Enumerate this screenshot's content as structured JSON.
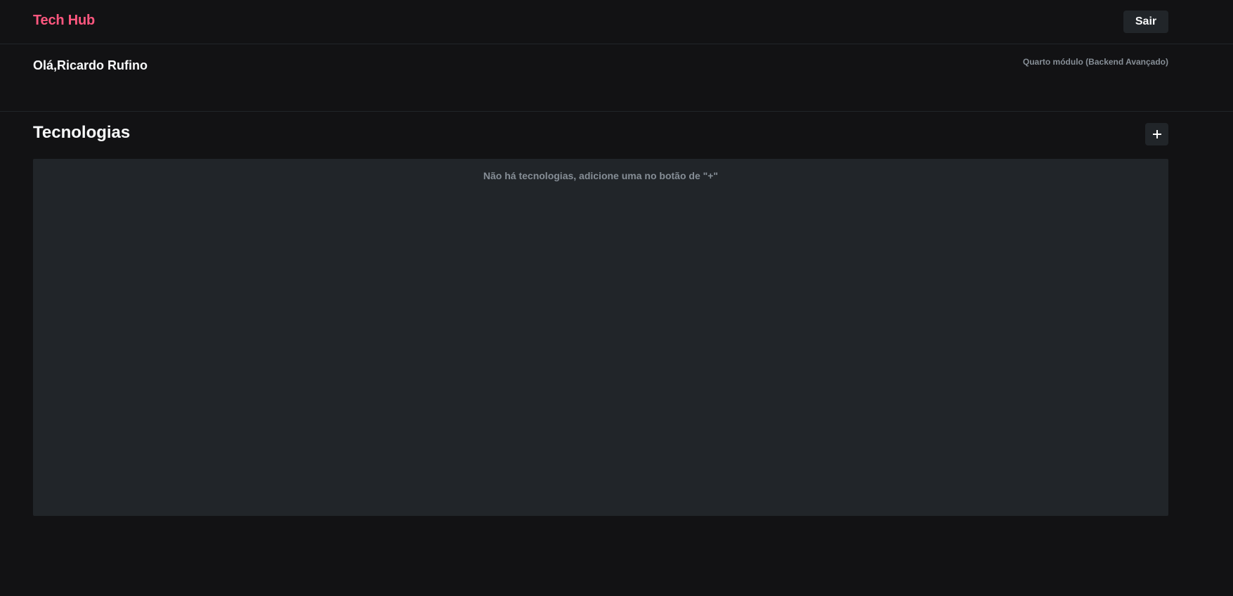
{
  "header": {
    "logo": "Tech Hub",
    "logout_label": "Sair"
  },
  "profile": {
    "greeting": "Olá,Ricardo Rufino",
    "module": "Quarto módulo (Backend Avançado)"
  },
  "technologies": {
    "title": "Tecnologias",
    "add_icon": "plus-icon",
    "empty_message": "Não há tecnologias, adicione uma no botão de \"+\""
  },
  "colors": {
    "background": "#121214",
    "panel": "#212529",
    "brand": "#ff577f",
    "text": "#f8f9fa",
    "muted": "#868e96"
  }
}
